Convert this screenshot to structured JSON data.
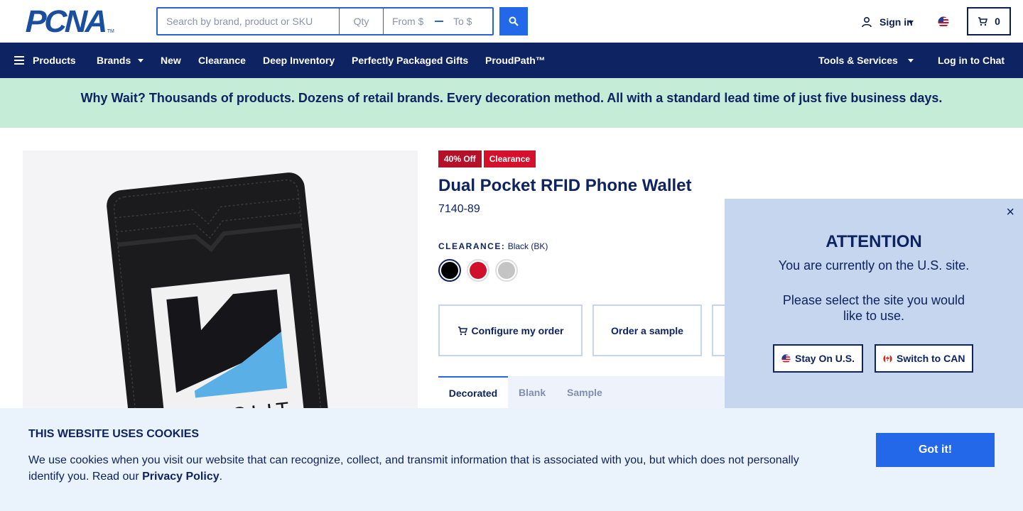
{
  "header": {
    "logo_text": "PCNA",
    "logo_tm": "TM",
    "search": {
      "placeholder": "Search by brand, product or SKU",
      "qty_placeholder": "Qty",
      "from_placeholder": "From $",
      "to_placeholder": "To $"
    },
    "signin_label": "Sign in",
    "cart_count": "0"
  },
  "nav": {
    "items": [
      "Products",
      "Brands",
      "New",
      "Clearance",
      "Deep Inventory",
      "Perfectly Packaged Gifts",
      "ProudPath™"
    ],
    "tools_label": "Tools & Services",
    "chat_label": "Log in to Chat"
  },
  "banner": {
    "text": "Why Wait? Thousands of products. Dozens of retail brands. Every decoration method. All with a standard lead time of just five business days."
  },
  "product": {
    "badges": [
      "40% Off",
      "Clearance"
    ],
    "title": "Dual Pocket RFID Phone Wallet",
    "sku": "7140-89",
    "color_label": "CLEARANCE:",
    "color_value": "Black (BK)",
    "swatches": [
      {
        "name": "Black",
        "color": "#000000",
        "selected": true
      },
      {
        "name": "Red",
        "color": "#d0102a",
        "selected": false
      },
      {
        "name": "Gray",
        "color": "#c4c4c4",
        "selected": false
      }
    ],
    "actions": {
      "configure": "Configure my order",
      "sample": "Order a sample"
    },
    "tabs": [
      "Decorated",
      "Blank",
      "Sample"
    ],
    "image_brand_text": "RENOLIT"
  },
  "attention": {
    "title": "ATTENTION",
    "line1": "You are currently on the U.S. site.",
    "line2": "Please select the site you would like to use.",
    "stay_label": "Stay On U.S.",
    "switch_label": "Switch to CAN",
    "close_symbol": "×"
  },
  "cookie": {
    "title": "THIS WEBSITE USES COOKIES",
    "text": "We use cookies when you visit our website that can recognize, collect, and transmit information that is associated with you, but which does not personally identify you. Read our ",
    "link": "Privacy Policy",
    "end": ".",
    "button": "Got it!"
  },
  "colors": {
    "navy": "#0e2361",
    "accent": "#2268e8",
    "banner": "#c4ecd7",
    "badge_red": "#d4102c"
  }
}
